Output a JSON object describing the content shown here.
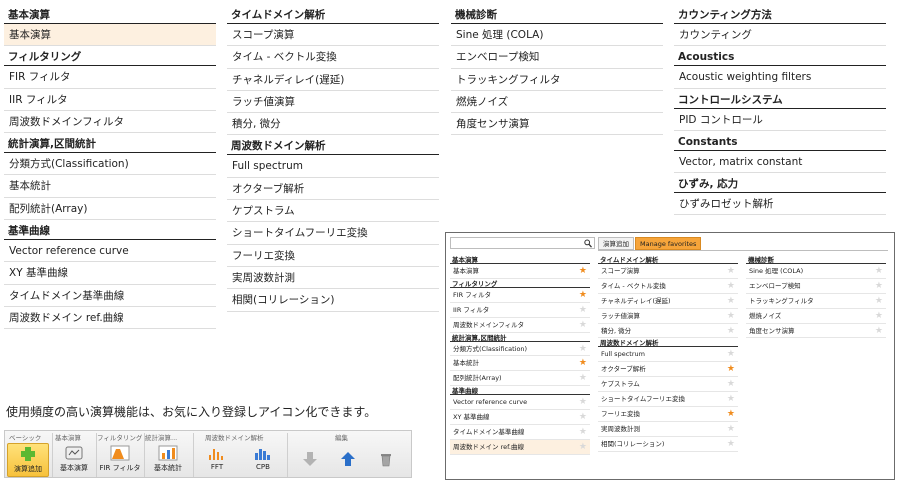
{
  "menu": {
    "columns": [
      {
        "sections": [
          {
            "title": "基本演算",
            "items": [
              {
                "label": "基本演算",
                "selected": true
              }
            ]
          },
          {
            "title": "フィルタリング",
            "items": [
              {
                "label": "FIR フィルタ"
              },
              {
                "label": "IIR フィルタ"
              },
              {
                "label": "周波数ドメインフィルタ"
              }
            ]
          },
          {
            "title": "統計演算,区間統計",
            "items": [
              {
                "label": "分類方式(Classification)"
              },
              {
                "label": "基本統計"
              },
              {
                "label": "配列統計(Array)"
              }
            ]
          },
          {
            "title": "基準曲線",
            "items": [
              {
                "label": "Vector reference curve"
              },
              {
                "label": "XY 基準曲線"
              },
              {
                "label": "タイムドメイン基準曲線"
              },
              {
                "label": "周波数ドメイン ref.曲線"
              }
            ]
          }
        ]
      },
      {
        "sections": [
          {
            "title": "タイムドメイン解析",
            "items": [
              {
                "label": "スコープ演算"
              },
              {
                "label": "タイム - ベクトル変換"
              },
              {
                "label": "チャネルディレイ(遅延)"
              },
              {
                "label": "ラッチ値演算"
              },
              {
                "label": "積分, 微分"
              }
            ]
          },
          {
            "title": "周波数ドメイン解析",
            "items": [
              {
                "label": "Full spectrum"
              },
              {
                "label": "オクターブ解析"
              },
              {
                "label": "ケプストラム"
              },
              {
                "label": "ショートタイムフーリエ変換"
              },
              {
                "label": "フーリエ変換"
              },
              {
                "label": "実周波数計測"
              },
              {
                "label": "相関(コリレーション)"
              }
            ]
          }
        ]
      },
      {
        "sections": [
          {
            "title": "機械診断",
            "items": [
              {
                "label": "Sine 処理 (COLA)"
              },
              {
                "label": "エンベロープ検知"
              },
              {
                "label": "トラッキングフィルタ"
              },
              {
                "label": "燃焼ノイズ"
              },
              {
                "label": "角度センサ演算"
              }
            ]
          }
        ]
      },
      {
        "sections": [
          {
            "title": "カウンティング方法",
            "items": [
              {
                "label": "カウンティング"
              }
            ]
          },
          {
            "title": "Acoustics",
            "items": [
              {
                "label": "Acoustic weighting filters"
              }
            ]
          },
          {
            "title": "コントロールシステム",
            "items": [
              {
                "label": "PID コントロール"
              }
            ]
          },
          {
            "title": "Constants",
            "items": [
              {
                "label": "Vector, matrix constant"
              }
            ]
          },
          {
            "title": "ひずみ, 応力",
            "items": [
              {
                "label": "ひずみロゼット解析"
              }
            ]
          }
        ]
      }
    ]
  },
  "caption": "使用頻度の高い演算機能は、お気に入り登録しアイコン化できます。",
  "toolbar": {
    "groups": {
      "basic": "ベーシック",
      "calc": "基本演算",
      "filter": "フィルタリング",
      "stats": "統計演算...",
      "freq": "周波数ドメイン解析",
      "edit": "編集"
    },
    "buttons": {
      "add": "演算追加",
      "calc": "基本演算",
      "fir": "FIR フィルタ",
      "stats": "基本統計",
      "fft": "FFT",
      "cpb": "CPB"
    }
  },
  "dialog": {
    "search_placeholder": "",
    "tabs": [
      "演算追加",
      "Manage favorites"
    ],
    "columns": [
      {
        "sections": [
          {
            "title": "基本演算",
            "items": [
              {
                "label": "基本演算",
                "fav": true
              }
            ]
          },
          {
            "title": "フィルタリング",
            "items": [
              {
                "label": "FIR フィルタ",
                "fav": true
              },
              {
                "label": "IIR フィルタ",
                "fav": false
              },
              {
                "label": "周波数ドメインフィルタ",
                "fav": false
              }
            ]
          },
          {
            "title": "統計演算,区間統計",
            "items": [
              {
                "label": "分類方式(Classification)",
                "fav": false
              },
              {
                "label": "基本統計",
                "fav": true
              },
              {
                "label": "配列統計(Array)",
                "fav": false
              }
            ]
          },
          {
            "title": "基準曲線",
            "items": [
              {
                "label": "Vector reference curve",
                "fav": false
              },
              {
                "label": "XY 基準曲線",
                "fav": false
              },
              {
                "label": "タイムドメイン基準曲線",
                "fav": false
              },
              {
                "label": "周波数ドメイン ref.曲線",
                "fav": false,
                "selected": true
              }
            ]
          }
        ]
      },
      {
        "sections": [
          {
            "title": "タイムドメイン解析",
            "items": [
              {
                "label": "スコープ演算",
                "fav": false
              },
              {
                "label": "タイム - ベクトル変換",
                "fav": false
              },
              {
                "label": "チャネルディレイ(遅延)",
                "fav": false
              },
              {
                "label": "ラッチ値演算",
                "fav": false
              },
              {
                "label": "積分, 微分",
                "fav": false
              }
            ]
          },
          {
            "title": "周波数ドメイン解析",
            "items": [
              {
                "label": "Full spectrum",
                "fav": false
              },
              {
                "label": "オクターブ解析",
                "fav": true
              },
              {
                "label": "ケプストラム",
                "fav": false
              },
              {
                "label": "ショートタイムフーリエ変換",
                "fav": false
              },
              {
                "label": "フーリエ変換",
                "fav": true
              },
              {
                "label": "実周波数計測",
                "fav": false
              },
              {
                "label": "相関(コリレーション)",
                "fav": false
              }
            ]
          }
        ]
      },
      {
        "sections": [
          {
            "title": "機械診断",
            "items": [
              {
                "label": "Sine 処理 (COLA)",
                "fav": false
              },
              {
                "label": "エンベロープ検知",
                "fav": false
              },
              {
                "label": "トラッキングフィルタ",
                "fav": false
              },
              {
                "label": "燃焼ノイズ",
                "fav": false
              },
              {
                "label": "角度センサ演算",
                "fav": false
              }
            ]
          }
        ]
      }
    ]
  },
  "colors": {
    "favorite_star": "#f08c1e",
    "active_tab": "#f6a43a",
    "selected_row": "#fdf0e0"
  }
}
